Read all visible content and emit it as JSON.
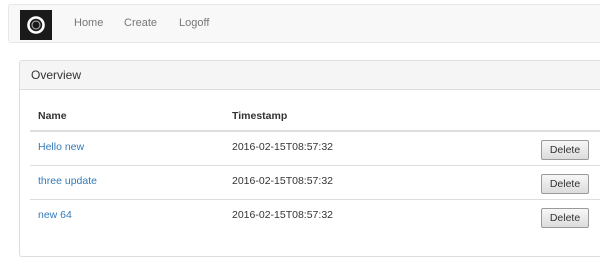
{
  "nav": {
    "brand_icon": "ring-logo-icon",
    "links": [
      "Home",
      "Create",
      "Logoff"
    ]
  },
  "panel": {
    "title": "Overview",
    "columns": [
      "Name",
      "Timestamp"
    ],
    "rows": [
      {
        "name": "Hello new",
        "timestamp": "2016-02-15T08:57:32",
        "action": "Delete"
      },
      {
        "name": "three update",
        "timestamp": "2016-02-15T08:57:32",
        "action": "Delete"
      },
      {
        "name": "new 64",
        "timestamp": "2016-02-15T08:57:32",
        "action": "Delete"
      }
    ]
  },
  "colors": {
    "link": "#337ab7",
    "navbar_bg": "#f8f8f8",
    "panel_heading_bg": "#f5f5f5",
    "brand_bg": "#1a1a1a"
  }
}
